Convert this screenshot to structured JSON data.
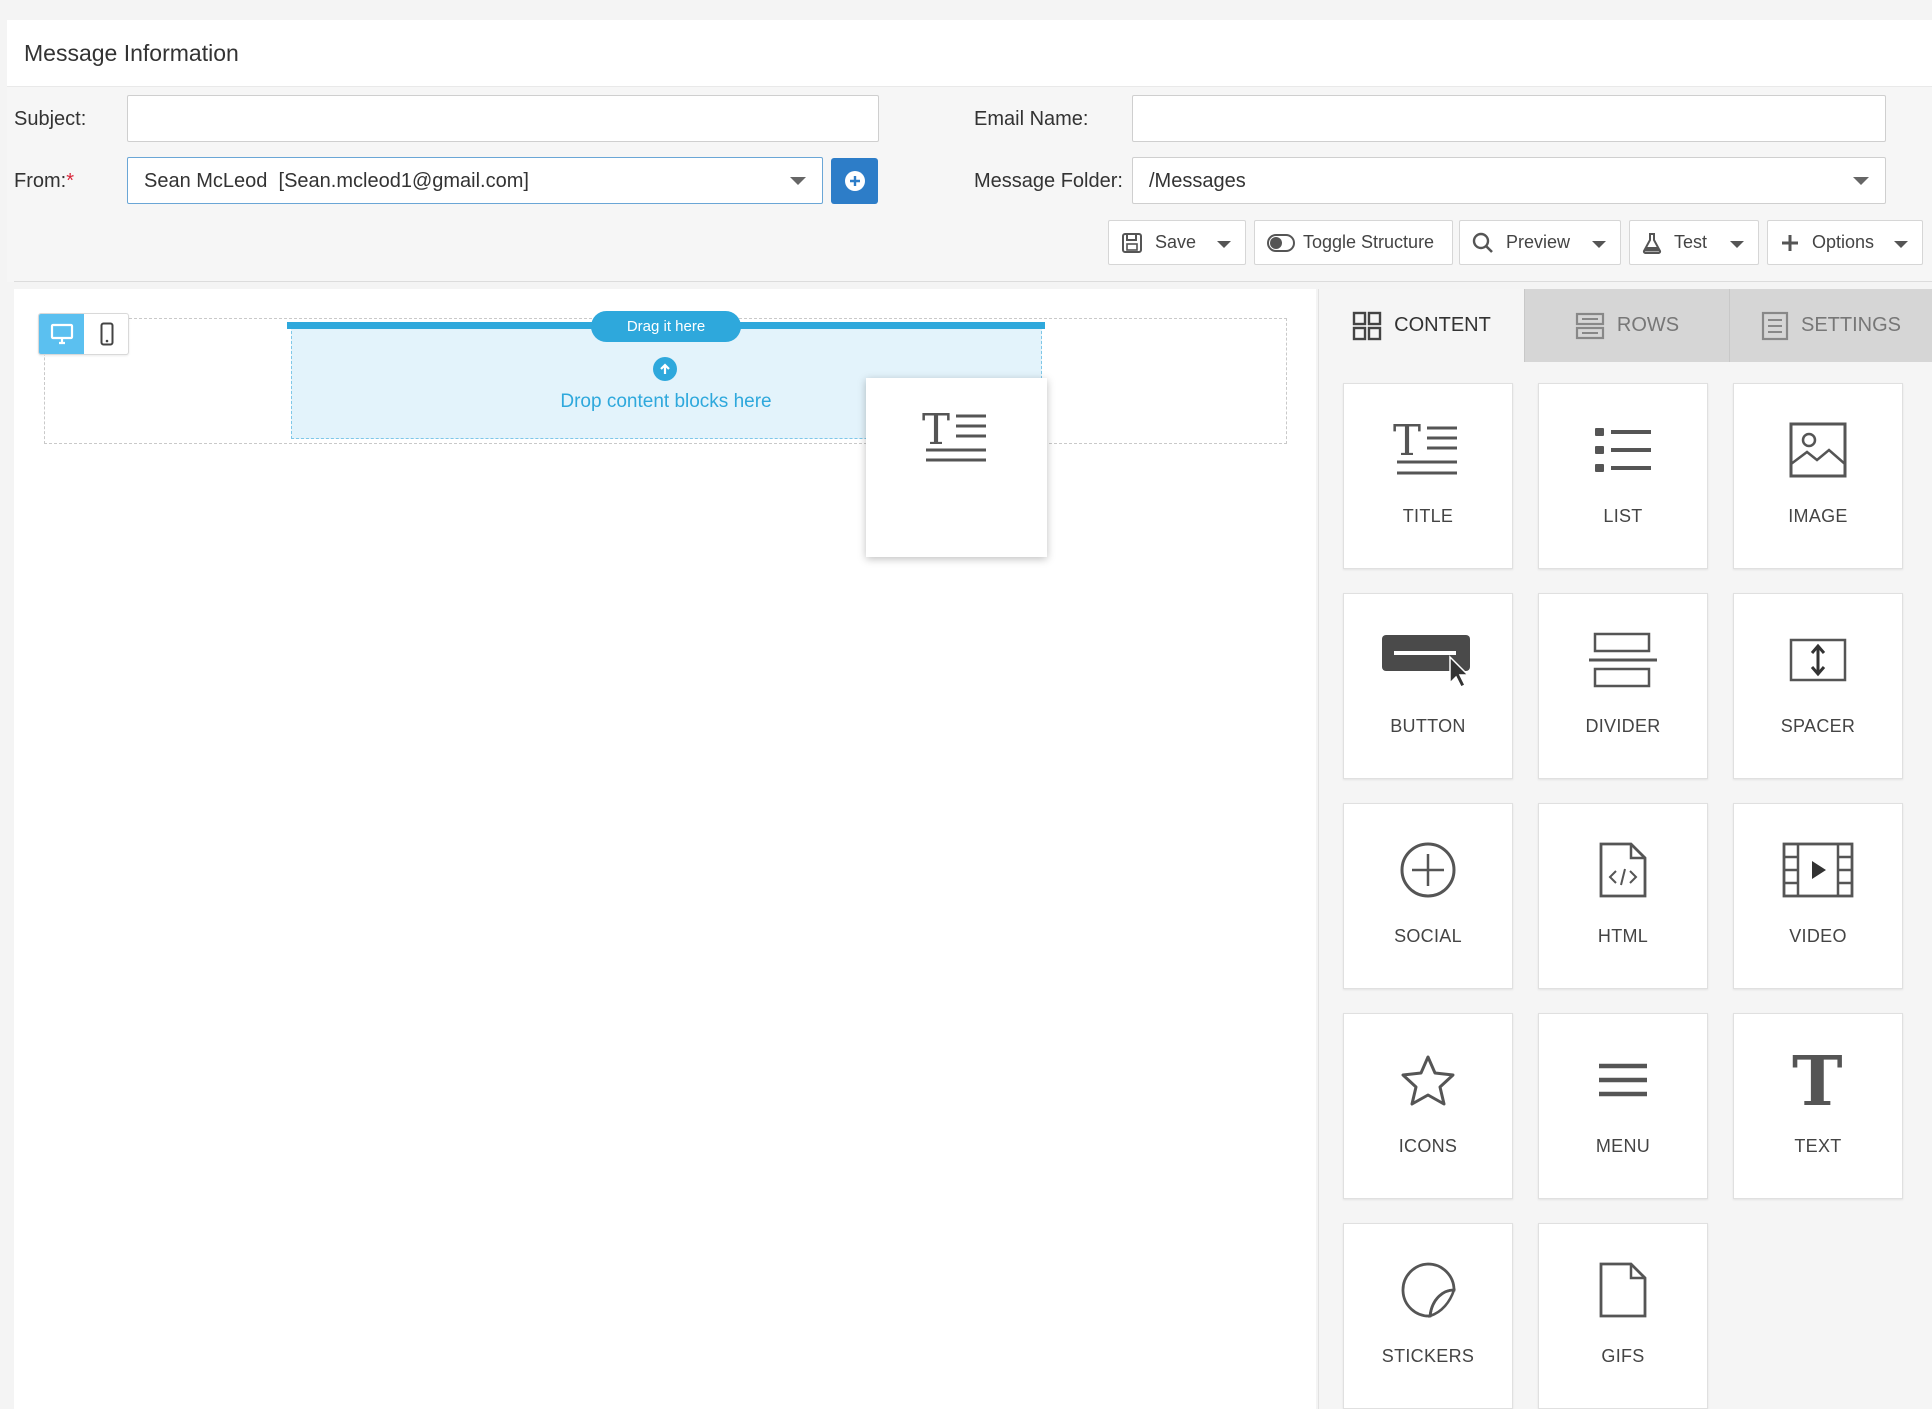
{
  "header": {
    "title": "Message Information"
  },
  "form": {
    "subject_label": "Subject:",
    "subject_value": "",
    "from_label": "From:",
    "from_required": "*",
    "from_value": "Sean McLeod  [Sean.mcleod1@gmail.com]",
    "email_name_label": "Email Name:",
    "email_name_value": "",
    "folder_label": "Message Folder:",
    "folder_value": "/Messages"
  },
  "toolbar": {
    "save": "Save",
    "toggle_structure": "Toggle Structure",
    "preview": "Preview",
    "test": "Test",
    "options": "Options"
  },
  "canvas": {
    "drag_hint": "Drag it here",
    "drop_text": "Drop content blocks here"
  },
  "panel": {
    "tabs": [
      {
        "label": "CONTENT",
        "icon": "grid-icon",
        "active": true
      },
      {
        "label": "ROWS",
        "icon": "rows-icon",
        "active": false
      },
      {
        "label": "SETTINGS",
        "icon": "settings-list-icon",
        "active": false
      }
    ],
    "blocks": [
      {
        "label": "TITLE",
        "icon": "title-icon"
      },
      {
        "label": "LIST",
        "icon": "list-icon"
      },
      {
        "label": "IMAGE",
        "icon": "image-icon"
      },
      {
        "label": "BUTTON",
        "icon": "button-icon"
      },
      {
        "label": "DIVIDER",
        "icon": "divider-icon"
      },
      {
        "label": "SPACER",
        "icon": "spacer-icon"
      },
      {
        "label": "SOCIAL",
        "icon": "social-plus-icon"
      },
      {
        "label": "HTML",
        "icon": "html-file-icon"
      },
      {
        "label": "VIDEO",
        "icon": "video-icon"
      },
      {
        "label": "ICONS",
        "icon": "star-icon"
      },
      {
        "label": "MENU",
        "icon": "menu-icon"
      },
      {
        "label": "TEXT",
        "icon": "text-icon"
      },
      {
        "label": "STICKERS",
        "icon": "sticker-icon"
      },
      {
        "label": "GIFS",
        "icon": "gif-file-icon"
      }
    ]
  },
  "colors": {
    "accent": "#2ea8dc",
    "primary_button": "#2d7dc8",
    "device_active": "#5bc0f0"
  }
}
